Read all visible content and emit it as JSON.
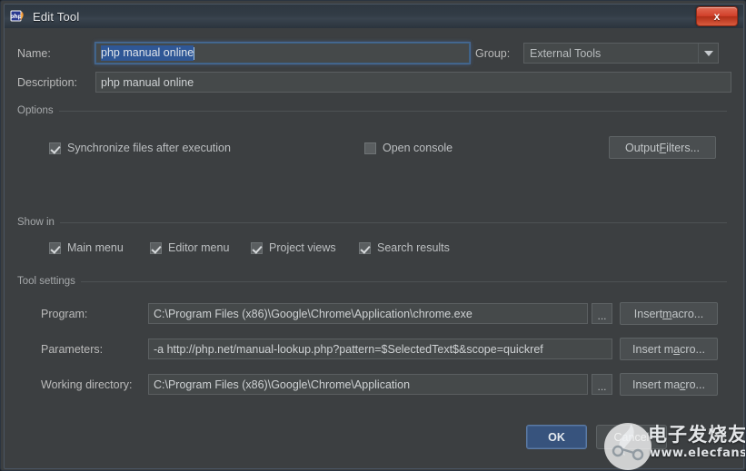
{
  "window": {
    "title": "Edit Tool",
    "icon": "php-storm-icon",
    "close_label": "x"
  },
  "form": {
    "name_label": "Name:",
    "name_value": "php manual online",
    "name_selected": true,
    "group_label": "Group:",
    "group_value": "External Tools",
    "description_label": "Description:",
    "description_value": "php manual online"
  },
  "options": {
    "section_label": "Options",
    "sync_files": {
      "label": "Synchronize files after execution",
      "checked": true
    },
    "open_console": {
      "label": "Open console",
      "checked": false
    },
    "output_filters_button": {
      "prefix": "Output ",
      "mnemonic": "F",
      "suffix": "ilters..."
    }
  },
  "show_in": {
    "section_label": "Show in",
    "items": [
      {
        "label": "Main menu",
        "checked": true
      },
      {
        "label": "Editor menu",
        "checked": true
      },
      {
        "label": "Project views",
        "checked": true
      },
      {
        "label": "Search results",
        "checked": true
      }
    ]
  },
  "tool_settings": {
    "section_label": "Tool settings",
    "program": {
      "label": "Program:",
      "value": "C:\\Program Files (x86)\\Google\\Chrome\\Application\\chrome.exe",
      "browse_label": "...",
      "macro_prefix": "Insert ",
      "macro_mnemonic": "m",
      "macro_suffix": "acro..."
    },
    "parameters": {
      "label": "Parameters:",
      "value": "-a  http://php.net/manual-lookup.php?pattern=$SelectedText$&scope=quickref",
      "macro_prefix": "Insert m",
      "macro_mnemonic": "a",
      "macro_suffix": "cro..."
    },
    "working_directory": {
      "label": "Working directory:",
      "value": "C:\\Program Files (x86)\\Google\\Chrome\\Application",
      "browse_label": "...",
      "macro_prefix": "Insert ma",
      "macro_mnemonic": "c",
      "macro_suffix": "ro..."
    }
  },
  "footer": {
    "ok_label": "OK",
    "cancel_label": "Cancel"
  },
  "watermark": {
    "chinese_text": "电子发烧友",
    "url": "www.elecfans.com"
  },
  "colors": {
    "dialog_background": "#3c3f41",
    "field_background": "#45494a",
    "accent_selection": "#2f5796",
    "ok_button": "#37537d",
    "close_button": "#d2402a",
    "text_primary": "#bbbbbb"
  }
}
